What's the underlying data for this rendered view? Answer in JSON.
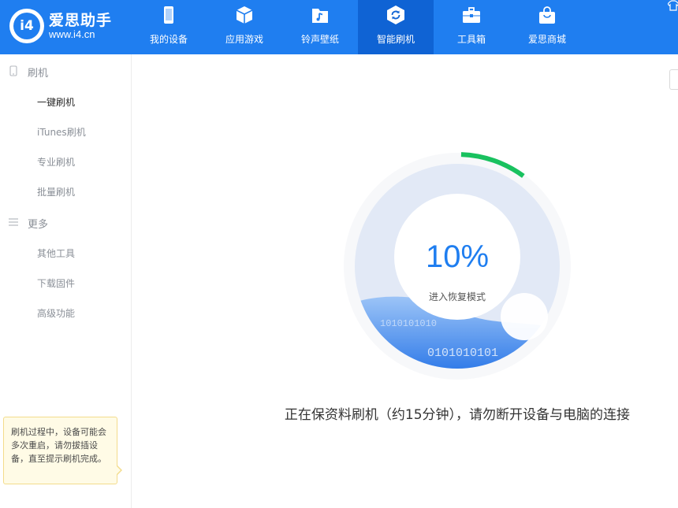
{
  "brand": {
    "name": "爱思助手",
    "url": "www.i4.cn",
    "mark": "i4",
    "primary_color": "#1f7ef0",
    "active_color": "#0f63d4"
  },
  "nav": [
    {
      "label": "我的设备",
      "icon": "phone-icon",
      "active": false
    },
    {
      "label": "应用游戏",
      "icon": "cube-icon",
      "active": false
    },
    {
      "label": "铃声壁纸",
      "icon": "music-folder-icon",
      "active": false
    },
    {
      "label": "智能刷机",
      "icon": "refresh-cycle-icon",
      "active": true
    },
    {
      "label": "工具箱",
      "icon": "toolbox-icon",
      "active": false
    },
    {
      "label": "爱思商城",
      "icon": "shopping-bag-icon",
      "active": false
    }
  ],
  "sidebar": {
    "sections": [
      {
        "label": "刷机",
        "icon": "phone-outline-icon",
        "items": [
          {
            "label": "一键刷机",
            "active": true
          },
          {
            "label": "iTunes刷机",
            "active": false
          },
          {
            "label": "专业刷机",
            "active": false
          },
          {
            "label": "批量刷机",
            "active": false
          }
        ]
      },
      {
        "label": "更多",
        "icon": "menu-lines-icon",
        "items": [
          {
            "label": "其他工具",
            "active": false
          },
          {
            "label": "下载固件",
            "active": false
          },
          {
            "label": "高级功能",
            "active": false
          }
        ]
      }
    ],
    "tip": "刷机过程中，设备可能会多次重启，请勿拔插设备，直至提示刷机完成。"
  },
  "progress": {
    "percent_text": "10%",
    "percent": 10,
    "phase": "进入恢复模式",
    "binary_text_1": "0101010101",
    "binary_text_2": "1010101010",
    "status": "正在保资料刷机（约15分钟），请勿断开设备与电脑的连接",
    "arc_color": "#19c15f"
  }
}
